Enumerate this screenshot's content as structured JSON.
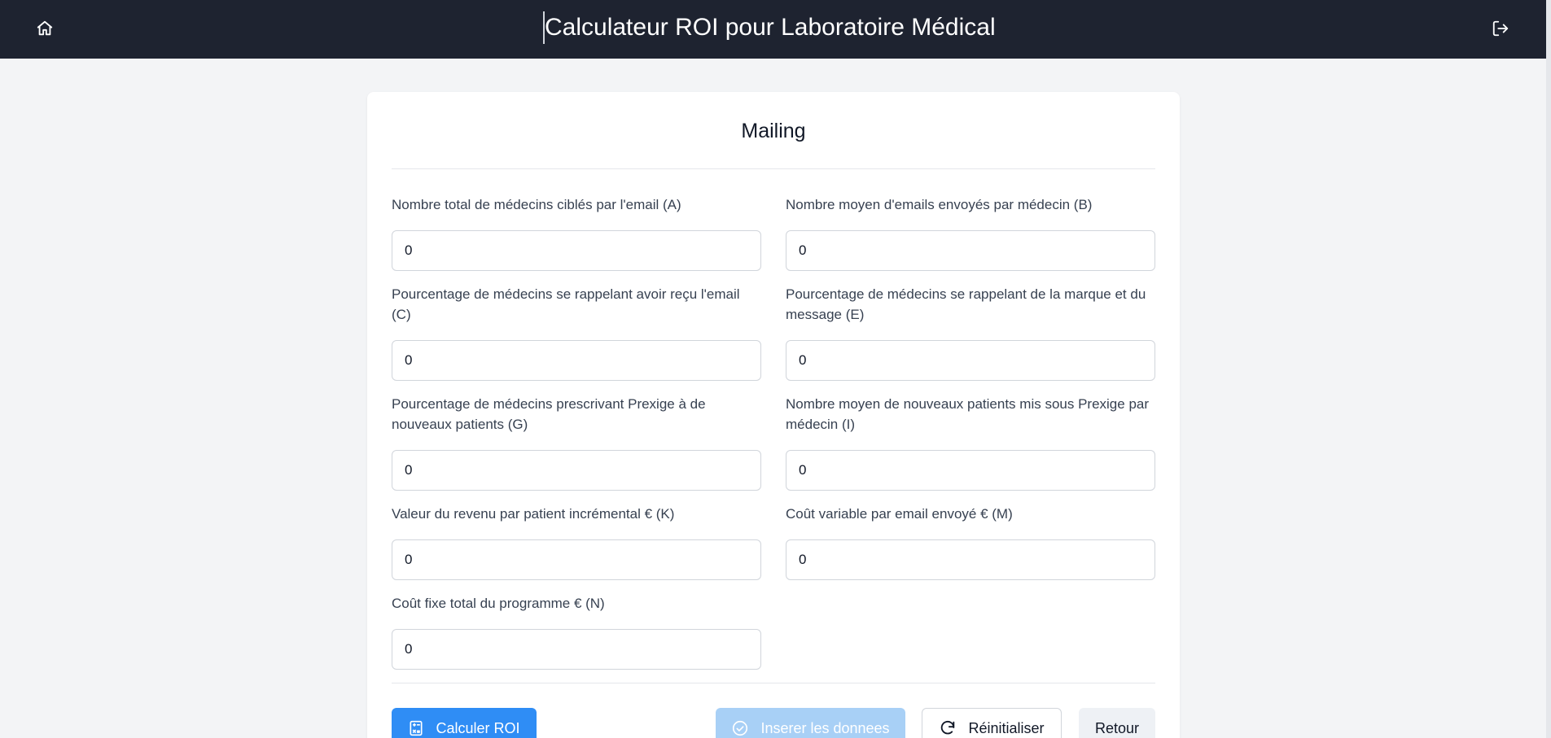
{
  "header": {
    "title": "Calculateur ROI pour Laboratoire Médical",
    "home_icon": "home-icon",
    "logout_icon": "logout-icon"
  },
  "form": {
    "title": "Mailing",
    "fields": [
      {
        "label": "Nombre total de médecins ciblés par l'email (A)",
        "value": "0"
      },
      {
        "label": "Nombre moyen d'emails envoyés par médecin (B)",
        "value": "0"
      },
      {
        "label": "Pourcentage de médecins se rappelant avoir reçu l'email (C)",
        "value": "0"
      },
      {
        "label": "Pourcentage de médecins se rappelant de la marque et du message (E)",
        "value": "0"
      },
      {
        "label": "Pourcentage de médecins prescrivant Prexige à de nouveaux patients (G)",
        "value": "0"
      },
      {
        "label": "Nombre moyen de nouveaux patients mis sous Prexige par médecin (I)",
        "value": "0"
      },
      {
        "label": "Valeur du revenu par patient incrémental € (K)",
        "value": "0"
      },
      {
        "label": "Coût variable par email envoyé € (M)",
        "value": "0"
      },
      {
        "label": "Coût fixe total du programme € (N)",
        "value": "0"
      }
    ]
  },
  "actions": {
    "calculate_label": "Calculer ROI",
    "insert_label": "Inserer les donnees",
    "reset_label": "Réinitialiser",
    "back_label": "Retour"
  },
  "colors": {
    "topbar": "#1e2330",
    "primary": "#2f8df5",
    "primary_disabled": "#a8d0f6"
  }
}
